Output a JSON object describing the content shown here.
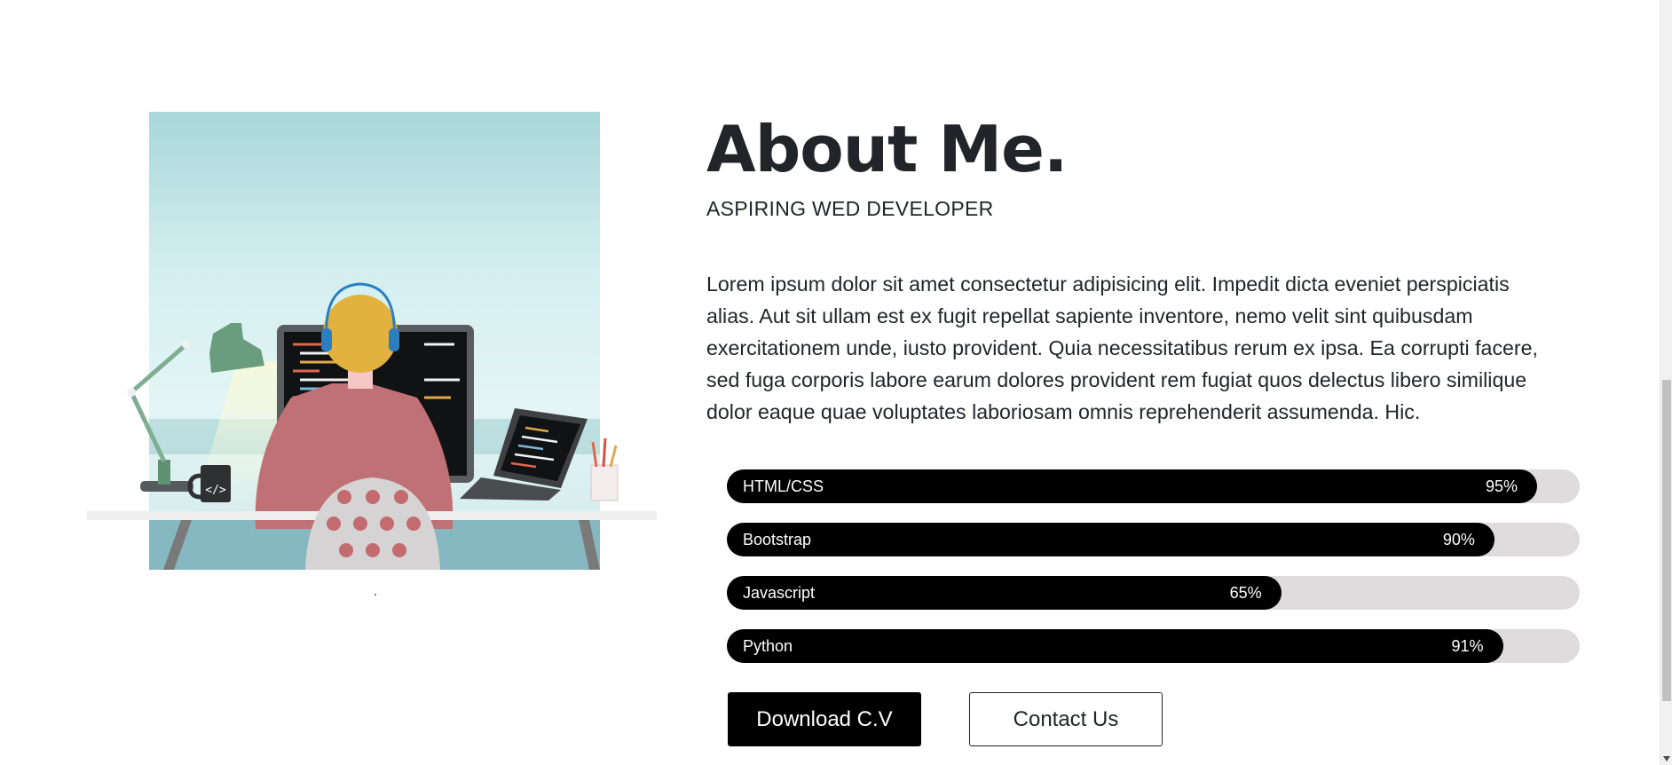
{
  "about": {
    "title": "About Me.",
    "subtitle": "ASPIRING WED DEVELOPER",
    "description": "Lorem ipsum dolor sit amet consectetur adipisicing elit. Impedit dicta eveniet perspiciatis alias. Aut sit ullam est ex fugit repellat sapiente inventore, nemo velit sint quibusdam exercitationem unde, iusto provident. Quia necessitatibus rerum ex ipsa. Ea corrupti facere, sed fuga corporis labore earum dolores provident rem fugiat quos delectus libero similique dolor eaque quae voluptates laboriosam omnis reprehenderit assumenda. Hic."
  },
  "illustration": {
    "mug_label": "</>",
    "icon": "developer-at-desk-illustration"
  },
  "skills": [
    {
      "name": "HTML/CSS",
      "percent_label": "95%",
      "value": 95
    },
    {
      "name": "Bootstrap",
      "percent_label": "90%",
      "value": 90
    },
    {
      "name": "Javascript",
      "percent_label": "65%",
      "value": 65
    },
    {
      "name": "Python",
      "percent_label": "91%",
      "value": 91
    }
  ],
  "buttons": {
    "download_label": "Download C.V",
    "contact_label": "Contact Us"
  },
  "colors": {
    "bar_fill": "#000000",
    "bar_track": "#dedcdc",
    "text": "#212529"
  }
}
